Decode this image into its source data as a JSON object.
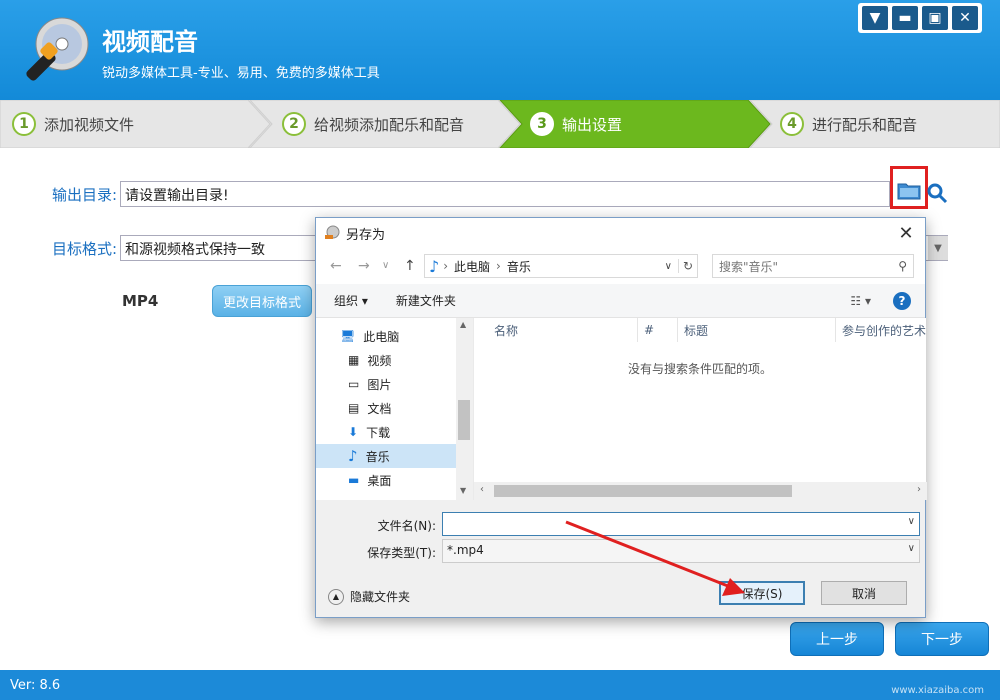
{
  "app": {
    "title": "视频配音",
    "subtitle": "锐动多媒体工具-专业、易用、免费的多媒体工具",
    "version": "Ver: 8.6",
    "watermark": "www.xiazaiba.com"
  },
  "steps": [
    {
      "num": "1",
      "label": "添加视频文件"
    },
    {
      "num": "2",
      "label": "给视频添加配乐和配音"
    },
    {
      "num": "3",
      "label": "输出设置"
    },
    {
      "num": "4",
      "label": "进行配乐和配音"
    }
  ],
  "output": {
    "dir_label": "输出目录:",
    "dir_value": "请设置输出目录!",
    "format_label": "目标格式:",
    "format_value": "和源视频格式保持一致",
    "format_name": "MP4",
    "change_format_btn": "更改目标格式"
  },
  "nav": {
    "prev": "上一步",
    "next": "下一步"
  },
  "dialog": {
    "title": "另存为",
    "breadcrumb": [
      "此电脑",
      "音乐"
    ],
    "search_placeholder": "搜索\"音乐\"",
    "organize": "组织",
    "new_folder": "新建文件夹",
    "tree": [
      {
        "label": "此电脑",
        "icon": "computer-icon"
      },
      {
        "label": "视频",
        "icon": "video-folder-icon"
      },
      {
        "label": "图片",
        "icon": "pictures-folder-icon"
      },
      {
        "label": "文档",
        "icon": "documents-folder-icon"
      },
      {
        "label": "下载",
        "icon": "download-folder-icon"
      },
      {
        "label": "音乐",
        "icon": "music-folder-icon",
        "selected": true
      },
      {
        "label": "桌面",
        "icon": "desktop-folder-icon"
      }
    ],
    "columns": [
      "名称",
      "#",
      "标题",
      "参与创作的艺术"
    ],
    "empty_message": "没有与搜索条件匹配的项。",
    "filename_label": "文件名(N):",
    "filename_value": "",
    "filetype_label": "保存类型(T):",
    "filetype_value": "*.mp4",
    "hide_folders": "隐藏文件夹",
    "save_btn": "保存(S)",
    "cancel_btn": "取消"
  },
  "colors": {
    "titlebar": "#1a8fdc",
    "active_step": "#6cb81e",
    "highlight": "#e02020"
  }
}
